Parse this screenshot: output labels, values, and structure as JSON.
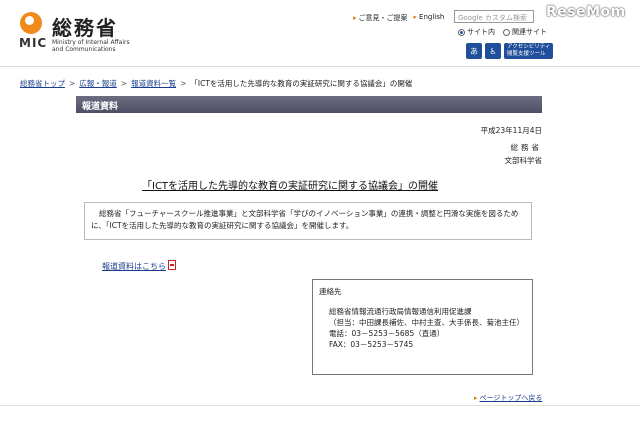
{
  "header": {
    "logo_jp": "総務省",
    "logo_abbr": "MIC",
    "logo_en_line1": "Ministry of Internal Affairs",
    "logo_en_line2": "and Communications",
    "links": [
      "ご意見・ご提案",
      "English"
    ],
    "search_placeholder": "Google カスタム検索",
    "radio_site": "サイト内",
    "radio_related": "関連サイト",
    "acc_label1": "アクセシビリティ",
    "acc_label2": "閲覧支援ツール",
    "watermark": "ReseMom"
  },
  "breadcrumb": {
    "items": [
      "総務省トップ",
      "広報・報道",
      "報道資料一覧"
    ],
    "current": "「ICTを活用した先導的な教育の実証研究に関する協議会」の開催"
  },
  "section_title": "報道資料",
  "date": "平成23年11月4日",
  "issuer1": "総務省",
  "issuer2": "文部科学省",
  "headline": "「ICTを活用した先導的な教育の実証研究に関する協議会」の開催",
  "summary": "総務省「フューチャースクール推進事業」と文部科学省「学びのイノベーション事業」の連携・調整と円滑な実施を図るために、「ICTを活用した先導的な教育の実証研究に関する協議会」を開催します。",
  "pdf_link": "報道資料はこちら",
  "contact": {
    "heading": "連絡先",
    "dept": "総務省情報流通行政局情報通信利用促進課",
    "staff": "（担当：中田課長補佐、中村主査、大手係長、菊池主任）",
    "phone": "電話：03－5253－5685（直通）",
    "fax": "FAX：03－5253－5745"
  },
  "back_to_top": "ページトップへ戻る"
}
